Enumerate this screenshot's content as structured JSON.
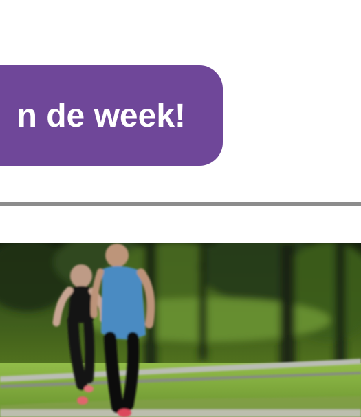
{
  "promo": {
    "button_label": "n de week!"
  },
  "colors": {
    "button_bg": "#6f4799",
    "divider": "#8c8c8c"
  },
  "hero": {
    "icon": "running-couple-photo"
  }
}
